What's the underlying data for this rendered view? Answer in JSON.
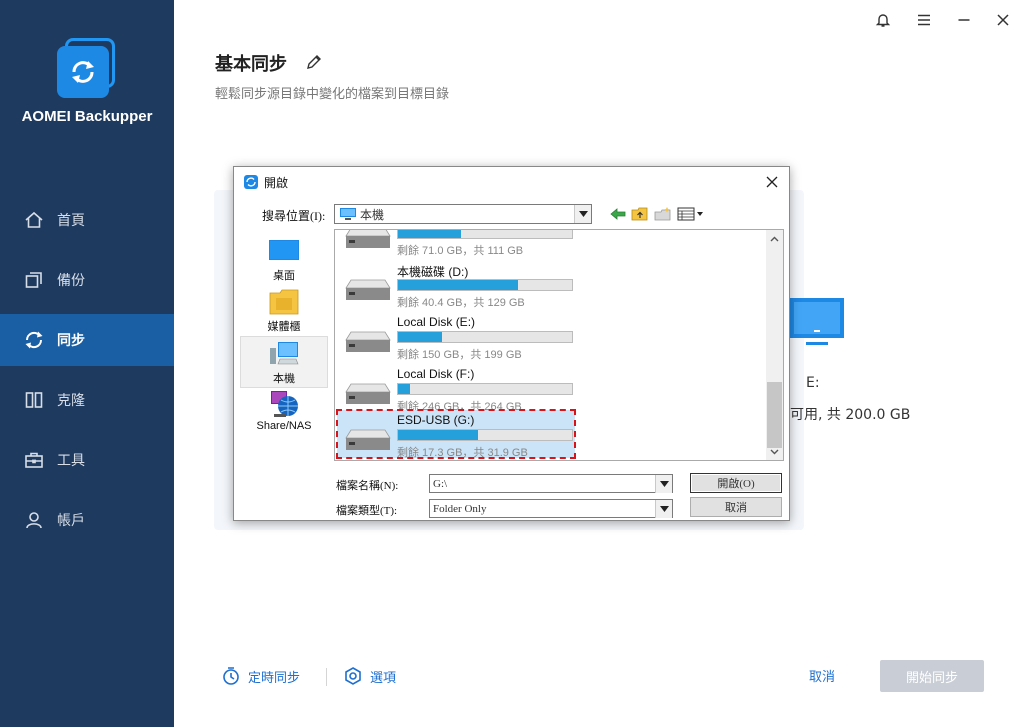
{
  "app": {
    "name": "AOMEI Backupper",
    "accent": "#1a5fa3",
    "sidebar_bg": "#1f3a5f"
  },
  "nav": [
    {
      "label": "首頁",
      "icon": "home-icon"
    },
    {
      "label": "備份",
      "icon": "backup-icon"
    },
    {
      "label": "同步",
      "icon": "sync-icon",
      "active": true
    },
    {
      "label": "克隆",
      "icon": "clone-icon"
    },
    {
      "label": "工具",
      "icon": "tools-icon"
    },
    {
      "label": "帳戶",
      "icon": "account-icon"
    }
  ],
  "header": {
    "title": "基本同步",
    "subtitle": "輕鬆同步源目錄中變化的檔案到目標目錄"
  },
  "destination": {
    "name": "E:",
    "size": "可用, 共 200.0 GB"
  },
  "footer": {
    "schedule": "定時同步",
    "options": "選項",
    "cancel": "取消",
    "start": "開始同步"
  },
  "dialog": {
    "title": "開啟",
    "lookin_label": "搜尋位置(I):",
    "lookin_value": "本機",
    "places": [
      {
        "label": "桌面",
        "icon": "desktop-icon"
      },
      {
        "label": "媒體櫃",
        "icon": "library-icon"
      },
      {
        "label": "本機",
        "icon": "this-pc-icon",
        "selected": true
      },
      {
        "label": "Share/NAS",
        "icon": "network-icon"
      }
    ],
    "drives": [
      {
        "name": "",
        "info": "剩餘 71.0 GB，共 111 GB",
        "used_fraction": 0.36
      },
      {
        "name": "本機磁碟 (D:)",
        "info": "剩餘 40.4 GB，共 129 GB",
        "used_fraction": 0.69
      },
      {
        "name": "Local Disk (E:)",
        "info": "剩餘 150 GB，共 199 GB",
        "used_fraction": 0.25
      },
      {
        "name": "Local Disk (F:)",
        "info": "剩餘 246 GB，共 264 GB",
        "used_fraction": 0.07
      },
      {
        "name": "ESD-USB (G:)",
        "info": "剩餘 17.3 GB，共 31.9 GB",
        "used_fraction": 0.46,
        "selected": true
      }
    ],
    "filename_label": "檔案名稱(N):",
    "filename_value": "G:\\",
    "filetype_label": "檔案類型(T):",
    "filetype_value": "Folder Only",
    "open_button": "開啟(O)",
    "cancel_button": "取消"
  }
}
